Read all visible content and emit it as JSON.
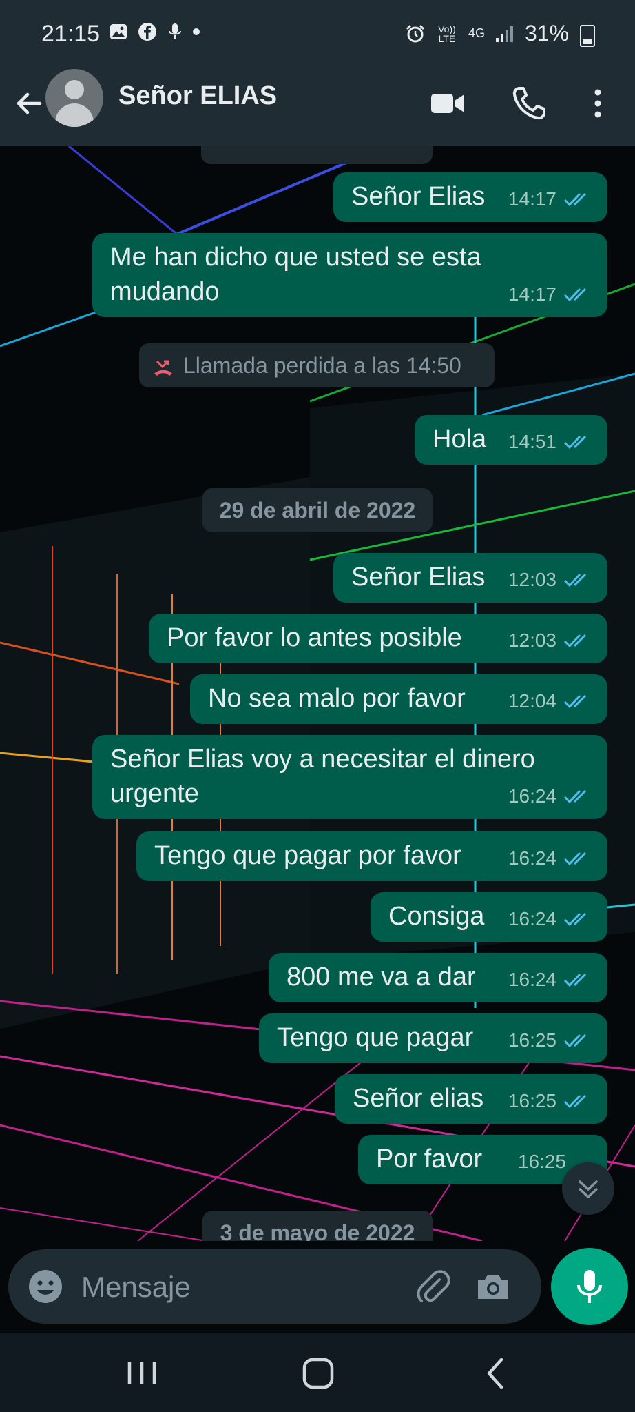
{
  "status_bar": {
    "time": "21:15",
    "network_label": "Vo)) LTE",
    "network_type": "4G",
    "battery": "31%"
  },
  "header": {
    "contact_name": "Señor ELIAS",
    "back_icon": "arrow-left-icon",
    "video_icon": "video-camera-icon",
    "call_icon": "phone-icon",
    "menu_icon": "more-vertical-icon"
  },
  "chat": {
    "messages": [
      {
        "text": "Señor Elias",
        "time": "14:17"
      },
      {
        "text": "Me han dicho que usted se esta mudando",
        "time": "14:17"
      },
      {
        "text": "Hola",
        "time": "14:51"
      },
      {
        "text": "Señor Elias",
        "time": "12:03"
      },
      {
        "text": "Por favor lo antes posible",
        "time": "12:03"
      },
      {
        "text": "No sea malo por favor",
        "time": "12:04"
      },
      {
        "text": "Señor Elias voy a necesitar el dinero urgente",
        "time": "16:24"
      },
      {
        "text": "Tengo que pagar por favor",
        "time": "16:24"
      },
      {
        "text": "Consiga",
        "time": "16:24"
      },
      {
        "text": "800 me va a dar",
        "time": "16:24"
      },
      {
        "text": "Tengo que pagar",
        "time": "16:25"
      },
      {
        "text": "Señor elias",
        "time": "16:25"
      },
      {
        "text": "Por favor",
        "time": "16:25"
      }
    ],
    "missed_call": "Llamada perdida a las 14:50",
    "date_1": "29 de abril de 2022",
    "date_2": "3 de mayo de 2022"
  },
  "composer": {
    "placeholder": "Mensaje"
  },
  "colors": {
    "outgoing_bubble": "#005c4b",
    "accent": "#00a884",
    "read_ticks": "#53bdeb",
    "missed_call": "#f15c6d"
  }
}
